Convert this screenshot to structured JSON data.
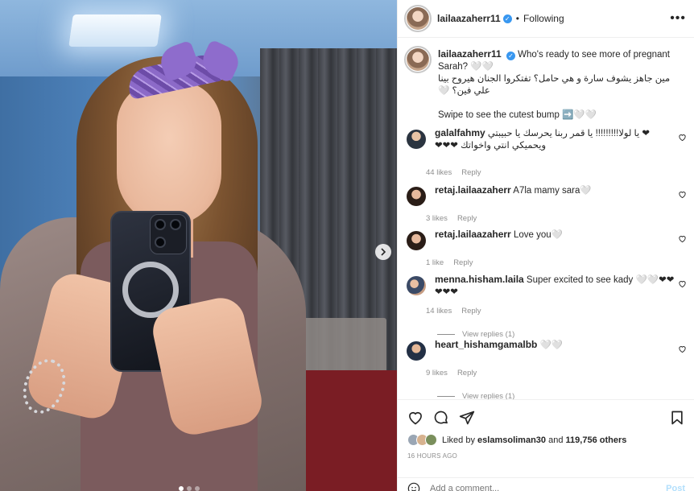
{
  "post": {
    "author": "lailaazaherr11",
    "follow_status": "Following",
    "header_separator": "•",
    "more_label": "•••",
    "caption_en": "Who's ready to see more of pregnant Sarah? 🤍🤍",
    "caption_ar": "مين جاهز يشوف سارة و هي حامل؟ تفتكروا الجنان هيروح بينا علي فين؟ 🤍",
    "caption_swipe": "Swipe to see the cutest bump ➡️🤍🤍",
    "verified_mark": "✓",
    "next_arrow": "›"
  },
  "comments": [
    {
      "user": "galalfahmy",
      "text": "❤ يا لولا!!!!!!!!! يا قمر ربنا يحرسك يا حبيبتي ويحميكي انتي واخواتك ❤❤❤",
      "likes": "44 likes",
      "reply": "Reply",
      "view_replies": ""
    },
    {
      "user": "retaj.lailaazaherr",
      "text": "A7la mamy sara🤍",
      "likes": "3 likes",
      "reply": "Reply",
      "view_replies": ""
    },
    {
      "user": "retaj.lailaazaherr",
      "text": "Love you🤍",
      "likes": "1 like",
      "reply": "Reply",
      "view_replies": ""
    },
    {
      "user": "menna.hisham.laila",
      "text": "Super excited to see kady 🤍🤍❤❤❤❤❤",
      "likes": "14 likes",
      "reply": "Reply",
      "view_replies": "View replies (1)"
    },
    {
      "user": "heart_hishamgamalbb",
      "text": "🤍🤍",
      "likes": "9 likes",
      "reply": "Reply",
      "view_replies": "View replies (1)"
    }
  ],
  "likes_summary": {
    "prefix": "Liked by",
    "user": "eslamsoliman30",
    "conjunction": "and",
    "count": "119,756 others"
  },
  "timestamp": "16 HOURS AGO",
  "comment_box": {
    "placeholder": "Add a comment...",
    "post_label": "Post"
  },
  "icons": {
    "like": "heart-icon",
    "comment": "comment-icon",
    "share": "paper-plane-icon",
    "save": "bookmark-icon",
    "emoji": "smiley-icon"
  },
  "colors": {
    "verified": "#3897f0",
    "post_button": "#b2dffc",
    "meta_text": "#8e8e8e",
    "text": "#262626"
  }
}
